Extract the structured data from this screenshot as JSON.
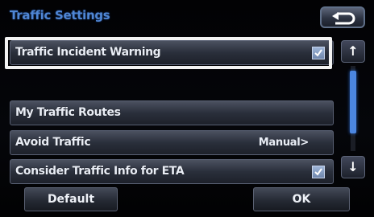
{
  "title": "Traffic Settings",
  "back_icon": "return-arrow-icon",
  "items": [
    {
      "label": "Traffic Incident Warning",
      "checked": true
    },
    {
      "label": "My Traffic Routes"
    },
    {
      "label": "Avoid Traffic",
      "value": "Manual>"
    },
    {
      "label": "Consider Traffic Info for ETA",
      "checked": true
    }
  ],
  "scroll": {
    "up_label": "↑",
    "down_label": "↓"
  },
  "buttons": {
    "default_label": "Default",
    "ok_label": "OK"
  },
  "colors": {
    "title": "#4f86d4",
    "highlight": "#f3f3f3",
    "scroll_thumb": "#4b86e0"
  }
}
